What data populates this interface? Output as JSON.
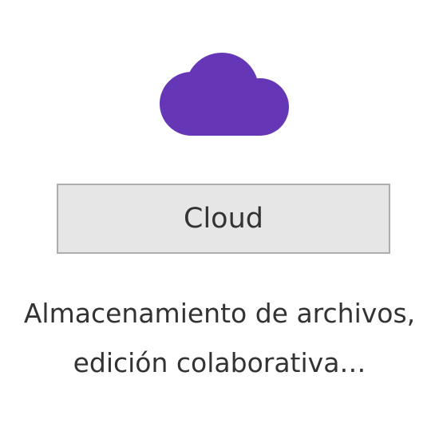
{
  "app": {
    "icon": "cloud-icon",
    "icon_color": "#6537b6",
    "button_label": "Cloud",
    "description_lines": [
      "Almacenamiento de archivos,",
      "edición colaborativa…"
    ]
  }
}
